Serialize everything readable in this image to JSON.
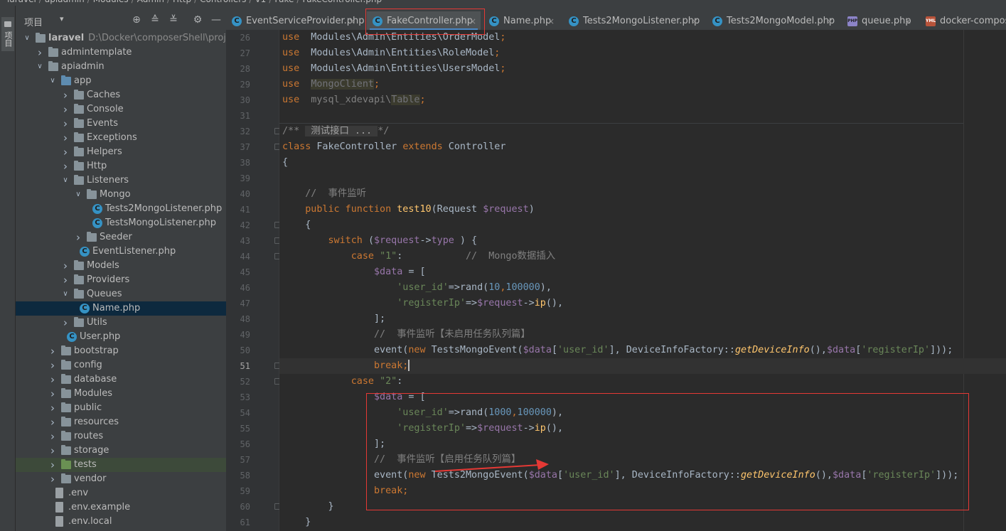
{
  "breadcrumb": [
    "laravel",
    "apiadmin",
    "Modules",
    "Admin",
    "Http",
    "Controllers",
    "V1",
    "Fake",
    "FakeController.php"
  ],
  "toolstrip": {
    "label": "项目"
  },
  "project": {
    "title": "项目",
    "tree": [
      {
        "depth": 0,
        "kind": "folder",
        "open": true,
        "label": "laravel",
        "path": "D:\\Docker\\composerShell\\project\\w",
        "root": true
      },
      {
        "depth": 1,
        "kind": "folder",
        "open": false,
        "label": "admintemplate"
      },
      {
        "depth": 1,
        "kind": "folder",
        "open": true,
        "label": "apiadmin"
      },
      {
        "depth": 2,
        "kind": "folder-blue",
        "open": true,
        "label": "app"
      },
      {
        "depth": 3,
        "kind": "folder",
        "open": false,
        "label": "Caches"
      },
      {
        "depth": 3,
        "kind": "folder",
        "open": false,
        "label": "Console"
      },
      {
        "depth": 3,
        "kind": "folder",
        "open": false,
        "label": "Events"
      },
      {
        "depth": 3,
        "kind": "folder",
        "open": false,
        "label": "Exceptions"
      },
      {
        "depth": 3,
        "kind": "folder",
        "open": false,
        "label": "Helpers"
      },
      {
        "depth": 3,
        "kind": "folder",
        "open": false,
        "label": "Http"
      },
      {
        "depth": 3,
        "kind": "folder",
        "open": true,
        "label": "Listeners"
      },
      {
        "depth": 4,
        "kind": "folder",
        "open": true,
        "label": "Mongo"
      },
      {
        "depth": 5,
        "kind": "class",
        "label": "Tests2MongoListener.php"
      },
      {
        "depth": 5,
        "kind": "class",
        "label": "TestsMongoListener.php"
      },
      {
        "depth": 4,
        "kind": "folder",
        "open": false,
        "label": "Seeder"
      },
      {
        "depth": 4,
        "kind": "class",
        "label": "EventListener.php"
      },
      {
        "depth": 3,
        "kind": "folder",
        "open": false,
        "label": "Models"
      },
      {
        "depth": 3,
        "kind": "folder",
        "open": false,
        "label": "Providers"
      },
      {
        "depth": 3,
        "kind": "folder",
        "open": true,
        "label": "Queues"
      },
      {
        "depth": 4,
        "kind": "class",
        "label": "Name.php",
        "selected": true
      },
      {
        "depth": 3,
        "kind": "folder",
        "open": false,
        "label": "Utils"
      },
      {
        "depth": 3,
        "kind": "class",
        "label": "User.php"
      },
      {
        "depth": 2,
        "kind": "folder",
        "open": false,
        "label": "bootstrap"
      },
      {
        "depth": 2,
        "kind": "folder",
        "open": false,
        "label": "config"
      },
      {
        "depth": 2,
        "kind": "folder",
        "open": false,
        "label": "database"
      },
      {
        "depth": 2,
        "kind": "folder",
        "open": false,
        "label": "Modules"
      },
      {
        "depth": 2,
        "kind": "folder",
        "open": false,
        "label": "public"
      },
      {
        "depth": 2,
        "kind": "folder",
        "open": false,
        "label": "resources"
      },
      {
        "depth": 2,
        "kind": "folder",
        "open": false,
        "label": "routes"
      },
      {
        "depth": 2,
        "kind": "folder",
        "open": false,
        "label": "storage"
      },
      {
        "depth": 2,
        "kind": "folder-green",
        "open": false,
        "label": "tests",
        "highlight": true
      },
      {
        "depth": 2,
        "kind": "folder",
        "open": false,
        "label": "vendor"
      },
      {
        "depth": 2,
        "kind": "file",
        "label": ".env"
      },
      {
        "depth": 2,
        "kind": "file",
        "label": ".env.example"
      },
      {
        "depth": 2,
        "kind": "file",
        "label": ".env.local"
      }
    ]
  },
  "tabs": [
    {
      "label": "EventServiceProvider.php",
      "icon": "class",
      "closable": true
    },
    {
      "label": "FakeController.php",
      "icon": "class",
      "closable": true,
      "active": true
    },
    {
      "label": "Name.php",
      "icon": "class",
      "closable": true
    },
    {
      "label": "Tests2MongoListener.php",
      "icon": "class",
      "closable": true
    },
    {
      "label": "Tests2MongoModel.php",
      "icon": "class",
      "closable": true
    },
    {
      "label": "queue.php",
      "icon": "php",
      "closable": true
    },
    {
      "label": "docker-compos",
      "icon": "yml",
      "closable": false
    }
  ],
  "editor": {
    "current_line": "51",
    "lines": [
      {
        "n": "26",
        "tokens": [
          [
            "kw",
            "use"
          ],
          [
            "",
            "  Modules\\Admin\\Entities\\OrderModel"
          ],
          [
            "kw",
            ";"
          ]
        ]
      },
      {
        "n": "27",
        "tokens": [
          [
            "kw",
            "use"
          ],
          [
            "",
            "  Modules\\Admin\\Entities\\RoleModel"
          ],
          [
            "kw",
            ";"
          ]
        ]
      },
      {
        "n": "28",
        "tokens": [
          [
            "kw",
            "use"
          ],
          [
            "",
            "  Modules\\Admin\\Entities\\UsersModel"
          ],
          [
            "kw",
            ";"
          ]
        ]
      },
      {
        "n": "29",
        "tokens": [
          [
            "kw",
            "use"
          ],
          [
            "",
            "  "
          ],
          [
            "unused",
            "MongoClient"
          ],
          [
            "kw",
            ";"
          ]
        ]
      },
      {
        "n": "30",
        "tokens": [
          [
            "kw",
            "use"
          ],
          [
            "cmt",
            "  mysql_xdevapi\\"
          ],
          [
            "unused",
            "Table"
          ],
          [
            "kw",
            ";"
          ]
        ]
      },
      {
        "n": "31",
        "tokens": []
      },
      {
        "n": "32",
        "tokens": [
          [
            "cmt",
            "/** "
          ],
          [
            "fold-hint",
            " 测试接口 ... "
          ],
          [
            "cmt",
            "*/"
          ]
        ]
      },
      {
        "n": "37",
        "tokens": [
          [
            "kw",
            "class"
          ],
          [
            "",
            " FakeController "
          ],
          [
            "kw",
            "extends"
          ],
          [
            "",
            " Controller"
          ]
        ]
      },
      {
        "n": "38",
        "tokens": [
          [
            "",
            "{"
          ]
        ]
      },
      {
        "n": "39",
        "tokens": []
      },
      {
        "n": "40",
        "tokens": [
          [
            "cmt",
            "    //  事件监听"
          ]
        ]
      },
      {
        "n": "41",
        "tokens": [
          [
            "kw",
            "    public function "
          ],
          [
            "fnn",
            "test10"
          ],
          [
            "",
            "(Request "
          ],
          [
            "var",
            "$request"
          ],
          [
            "",
            ")"
          ]
        ]
      },
      {
        "n": "42",
        "tokens": [
          [
            "",
            "    {"
          ]
        ]
      },
      {
        "n": "43",
        "tokens": [
          [
            "kw",
            "        switch "
          ],
          [
            "",
            "("
          ],
          [
            "var",
            "$request"
          ],
          [
            "",
            "->"
          ],
          [
            "var",
            "type"
          ],
          [
            "",
            " ) {"
          ]
        ]
      },
      {
        "n": "44",
        "tokens": [
          [
            "kw",
            "            case "
          ],
          [
            "str",
            "\"1\""
          ],
          [
            "",
            ":           "
          ],
          [
            "cmt",
            "//  Mongo数据插入"
          ]
        ]
      },
      {
        "n": "45",
        "tokens": [
          [
            "var",
            "                $data"
          ],
          [
            "",
            " = ["
          ]
        ]
      },
      {
        "n": "46",
        "tokens": [
          [
            "str",
            "                    'user_id'"
          ],
          [
            "",
            "=>rand("
          ],
          [
            "num",
            "10"
          ],
          [
            "kw",
            ","
          ],
          [
            "num",
            "100000"
          ],
          [
            "",
            "),"
          ]
        ]
      },
      {
        "n": "47",
        "tokens": [
          [
            "str",
            "                    'registerIp'"
          ],
          [
            "",
            "=>"
          ],
          [
            "var",
            "$request"
          ],
          [
            "",
            "->"
          ],
          [
            "fnn",
            "ip"
          ],
          [
            "",
            "(),"
          ]
        ]
      },
      {
        "n": "48",
        "tokens": [
          [
            "",
            "                ];"
          ]
        ]
      },
      {
        "n": "49",
        "tokens": [
          [
            "cmt",
            "                //  事件监听【未启用任务队列篇】"
          ]
        ]
      },
      {
        "n": "50",
        "tokens": [
          [
            "",
            "                event("
          ],
          [
            "kw",
            "new "
          ],
          [
            "",
            "TestsMongoEvent("
          ],
          [
            "var",
            "$data"
          ],
          [
            "",
            "["
          ],
          [
            "str",
            "'user_id'"
          ],
          [
            "",
            "], DeviceInfoFactory::"
          ],
          [
            "fn",
            "getDeviceInfo"
          ],
          [
            "",
            "(),"
          ],
          [
            "var",
            "$data"
          ],
          [
            "",
            "["
          ],
          [
            "str",
            "'registerIp'"
          ],
          [
            "",
            "]));"
          ]
        ]
      },
      {
        "n": "51",
        "tokens": [
          [
            "kw",
            "                break;"
          ],
          [
            "caret",
            ""
          ]
        ]
      },
      {
        "n": "52",
        "tokens": [
          [
            "kw",
            "            case "
          ],
          [
            "str",
            "\"2\""
          ],
          [
            "",
            ":"
          ]
        ]
      },
      {
        "n": "53",
        "tokens": [
          [
            "var",
            "                $data"
          ],
          [
            "",
            " = ["
          ]
        ]
      },
      {
        "n": "54",
        "tokens": [
          [
            "str",
            "                    'user_id'"
          ],
          [
            "",
            "=>rand("
          ],
          [
            "num",
            "1000"
          ],
          [
            "kw",
            ","
          ],
          [
            "num",
            "100000"
          ],
          [
            "",
            "),"
          ]
        ]
      },
      {
        "n": "55",
        "tokens": [
          [
            "str",
            "                    'registerIp'"
          ],
          [
            "",
            "=>"
          ],
          [
            "var",
            "$request"
          ],
          [
            "",
            "->"
          ],
          [
            "fnn",
            "ip"
          ],
          [
            "",
            "(),"
          ]
        ]
      },
      {
        "n": "56",
        "tokens": [
          [
            "",
            "                ];"
          ]
        ]
      },
      {
        "n": "57",
        "tokens": [
          [
            "cmt",
            "                //  事件监听【启用任务队列篇】"
          ]
        ]
      },
      {
        "n": "58",
        "tokens": [
          [
            "",
            "                event("
          ],
          [
            "kw",
            "new "
          ],
          [
            "",
            "Tests2MongoEvent("
          ],
          [
            "var",
            "$data"
          ],
          [
            "",
            "["
          ],
          [
            "str",
            "'user_id'"
          ],
          [
            "",
            "], DeviceInfoFactory::"
          ],
          [
            "fn",
            "getDeviceInfo"
          ],
          [
            "",
            "(),"
          ],
          [
            "var",
            "$data"
          ],
          [
            "",
            "["
          ],
          [
            "str",
            "'registerIp'"
          ],
          [
            "",
            "]));"
          ]
        ]
      },
      {
        "n": "59",
        "tokens": [
          [
            "kw",
            "                break;"
          ]
        ]
      },
      {
        "n": "60",
        "tokens": [
          [
            "",
            "        }"
          ]
        ]
      },
      {
        "n": "61",
        "tokens": [
          [
            "",
            "    }"
          ]
        ]
      }
    ]
  },
  "colors": {
    "annotation_red": "#e53935",
    "accent_blue": "#4a88c7",
    "keyword": "#cc7832",
    "string": "#6a8759"
  }
}
